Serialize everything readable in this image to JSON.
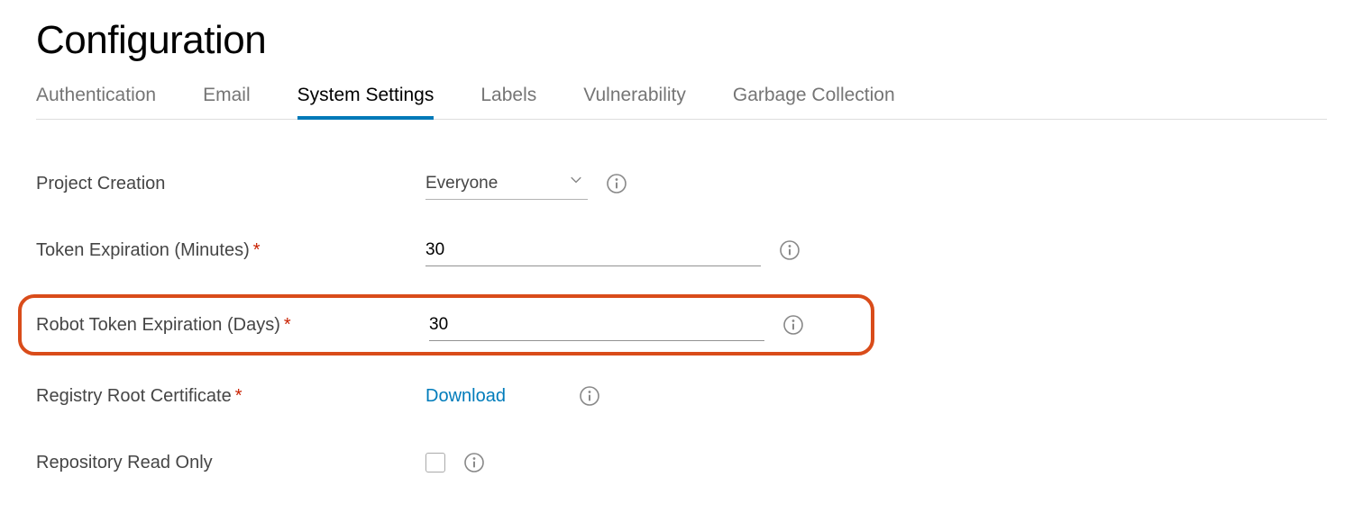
{
  "page": {
    "title": "Configuration"
  },
  "tabs": {
    "authentication": "Authentication",
    "email": "Email",
    "system_settings": "System Settings",
    "labels": "Labels",
    "vulnerability": "Vulnerability",
    "garbage_collection": "Garbage Collection"
  },
  "settings": {
    "project_creation": {
      "label": "Project Creation",
      "value": "Everyone"
    },
    "token_expiration": {
      "label": "Token Expiration (Minutes)",
      "value": "30"
    },
    "robot_token_expiration": {
      "label": "Robot Token Expiration (Days)",
      "value": "30"
    },
    "registry_root_cert": {
      "label": "Registry Root Certificate",
      "link_text": "Download"
    },
    "repo_read_only": {
      "label": "Repository Read Only",
      "checked": false
    }
  }
}
